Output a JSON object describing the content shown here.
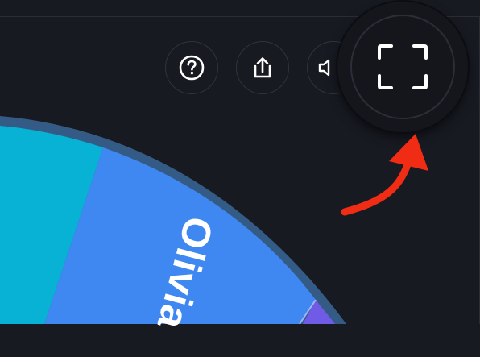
{
  "toolbar": {
    "help_icon": "question-circle-icon",
    "share_icon": "share-upload-icon",
    "sound_icon": "speaker-icon",
    "fullscreen_icon": "fullscreen-corners-icon"
  },
  "wheel": {
    "segment_label": "Olivia",
    "colors": {
      "teal": "#07b2d4",
      "blue": "#3f87f1",
      "purple": "#6f5be6",
      "rim": "#345b85"
    }
  },
  "annotation": {
    "arrow_color": "#f02d14",
    "arrow_icon": "curved-arrow-icon"
  }
}
